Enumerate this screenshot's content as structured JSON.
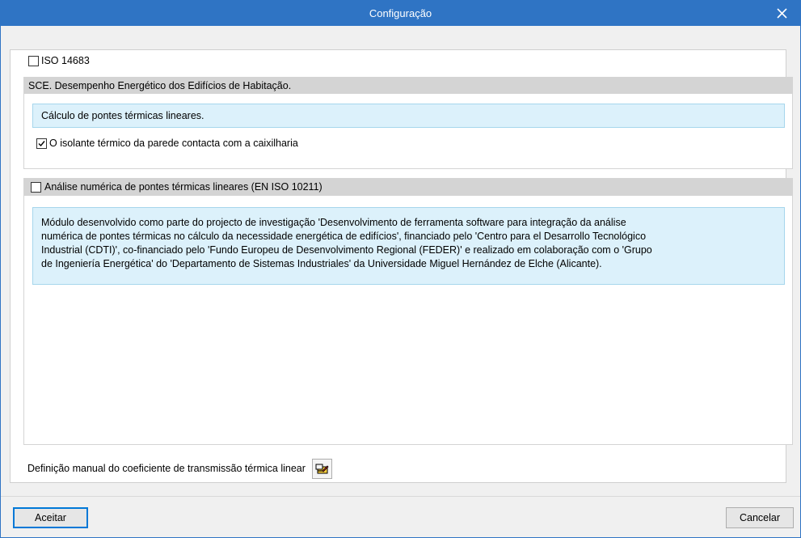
{
  "window": {
    "title": "Configuração",
    "close_icon": "close-icon"
  },
  "iso": {
    "label": "ISO 14683",
    "checked": false
  },
  "sce": {
    "header": "SCE. Desempenho Energético dos Edifícios de Habitação.",
    "info": "Cálculo de pontes térmicas lineares.",
    "insulation_label": "O isolante térmico da parede contacta com a caixilharia",
    "insulation_checked": true
  },
  "numeric": {
    "header_label": "Análise numérica de pontes térmicas lineares (EN ISO 10211)",
    "checked": false,
    "info_lines": [
      "Módulo desenvolvido como parte do projecto de investigação 'Desenvolvimento de ferramenta software para integração da análise",
      "numérica de pontes térmicas no cálculo da necessidade energética de edifícios', financiado pelo 'Centro para el Desarrollo Tecnológico",
      "Industrial (CDTI)', co-financiado pelo 'Fundo Europeu de Desenvolvimento Regional (FEDER)' e realizado em colaboração com o 'Grupo",
      "de Ingeniería Energética' do 'Departamento de Sistemas Industriales' da Universidade Miguel Hernández de Elche (Alicante)."
    ]
  },
  "manual": {
    "label": "Definição manual do coeficiente de transmissão térmica linear",
    "button_icon": "edit-icon"
  },
  "footer": {
    "accept": "Aceitar",
    "cancel": "Cancelar"
  },
  "colors": {
    "titlebar": "#2f74c4",
    "info_bg": "#dcf1fb",
    "section_header": "#d4d4d4"
  }
}
